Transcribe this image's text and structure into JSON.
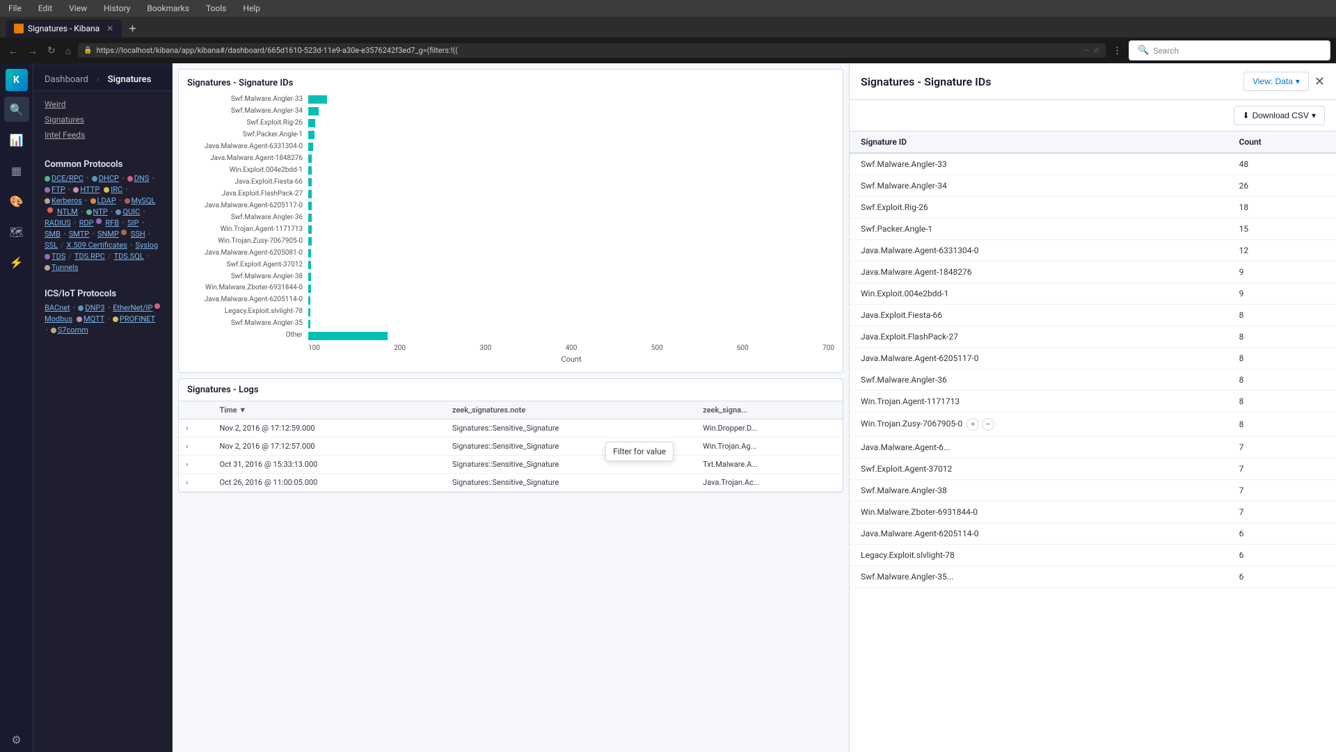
{
  "browser": {
    "menu": [
      "File",
      "Edit",
      "View",
      "History",
      "Bookmarks",
      "Tools",
      "Help"
    ],
    "tab_title": "Signatures - Kibana",
    "url": "https://localhost/kibana/app/kibana#/dashboard/665d1610-523d-11e9-a30e-e3576242f3ed7_g=(filters:!((",
    "search_placeholder": "Search"
  },
  "kibana": {
    "nav_items": [
      "discover",
      "visualize",
      "dashboard",
      "canvas",
      "maps",
      "ml",
      "settings"
    ],
    "header": {
      "breadcrumbs": [
        "Dashboard",
        "Signatures"
      ]
    }
  },
  "sidebar": {
    "items": [
      "Weird",
      "Signatures",
      "Intel Feeds"
    ],
    "common_protocols_title": "Common Protocols",
    "protocols": [
      {
        "label": "DCE/RPC",
        "color": "#54b399"
      },
      {
        "label": "DHCP",
        "color": "#6092c0"
      },
      {
        "label": "DNS",
        "color": "#d36086"
      },
      {
        "label": "FTP",
        "color": "#9170b8"
      },
      {
        "label": "HTTP",
        "color": "#ca8eae"
      },
      {
        "label": "IRC",
        "color": "#d6bf57"
      },
      {
        "label": "Kerberos",
        "color": "#b9a888"
      },
      {
        "label": "LDAP",
        "color": "#da8b45"
      },
      {
        "label": "MySQL",
        "color": "#aa6556"
      },
      {
        "label": "NTLM",
        "color": "#e7664c"
      },
      {
        "label": "NTP",
        "color": "#54b399"
      },
      {
        "label": "QUIC",
        "color": "#6092c0"
      },
      {
        "label": "RADIUS",
        "color": "#d36086"
      },
      {
        "label": "RDP",
        "color": "#9170b8"
      },
      {
        "label": "RFB",
        "color": "#ca8eae"
      },
      {
        "label": "SIP",
        "color": "#d6bf57"
      },
      {
        "label": "SMB",
        "color": "#b9a888"
      },
      {
        "label": "SMTP",
        "color": "#da8b45"
      },
      {
        "label": "SNMP",
        "color": "#aa6556"
      },
      {
        "label": "SSH",
        "color": "#e7664c"
      },
      {
        "label": "SSL",
        "color": "#54b399"
      },
      {
        "label": "X.509 Certificates",
        "color": "#6092c0"
      },
      {
        "label": "Syslog",
        "color": "#d36086"
      },
      {
        "label": "TDS",
        "color": "#9170b8"
      },
      {
        "label": "TDS.RPC",
        "color": "#ca8eae"
      },
      {
        "label": "TDS.SQL",
        "color": "#d6bf57"
      },
      {
        "label": "Tunnels",
        "color": "#b9a888"
      }
    ],
    "ics_title": "ICS/IoT Protocols",
    "ics_protocols": [
      {
        "label": "BACnet",
        "color": "#54b399"
      },
      {
        "label": "DNP3",
        "color": "#6092c0"
      },
      {
        "label": "EtherNet/IP",
        "color": "#d36086"
      },
      {
        "label": "Modbus",
        "color": "#9170b8"
      },
      {
        "label": "MQTT",
        "color": "#ca8eae"
      },
      {
        "label": "PROFINET",
        "color": "#d6bf57"
      },
      {
        "label": "S7comm",
        "color": "#b9a888"
      }
    ]
  },
  "chart": {
    "title": "Signatures - Signature IDs",
    "y_labels": [
      "Swf.Malware.Angler-33",
      "Swf.Malware.Angler-34",
      "Swf.Exploit.Rig-26",
      "Swf.Packer.Angle-1",
      "Java.Malware.Agent-6331304-0",
      "Java.Malware.Agent-1848276",
      "Win.Exploit.004e2bdd-1",
      "Java.Exploit.Fiesta-66",
      "Java.Exploit.FlashPack-27",
      "Java.Malware.Agent-6205117-0",
      "Swf.Malware.Angler-36",
      "Win.Trojan.Agent-1171713",
      "Win.Trojan.Zusy-7067905-0",
      "Java.Malware.Agent-6205081-0",
      "Swf.Exploit.Agent-37012",
      "Swf.Malware.Angler-38",
      "Win.Malware.Zboter-6931844-0",
      "Java.Malware.Agent-6205114-0",
      "Legacy.Exploit.slvlight-78",
      "Swf.Malware.Angler-35",
      "Other"
    ],
    "bar_values": [
      48,
      26,
      18,
      15,
      12,
      9,
      9,
      8,
      8,
      8,
      8,
      8,
      8,
      7,
      7,
      7,
      7,
      6,
      6,
      6,
      200
    ],
    "max_value": 700,
    "x_ticks": [
      "100",
      "200",
      "300",
      "400",
      "500",
      "600",
      "700"
    ],
    "x_label": "Count"
  },
  "flyout": {
    "title": "Signatures - Signature IDs",
    "view_data_label": "View: Data",
    "download_csv_label": "Download CSV",
    "table": {
      "columns": [
        "Signature ID",
        "Count"
      ],
      "rows": [
        {
          "id": "Swf.Malware.Angler-33",
          "count": 48
        },
        {
          "id": "Swf.Malware.Angler-34",
          "count": 26
        },
        {
          "id": "Swf.Exploit.Rig-26",
          "count": 18
        },
        {
          "id": "Swf.Packer.Angle-1",
          "count": 15
        },
        {
          "id": "Java.Malware.Agent-6331304-0",
          "count": 12
        },
        {
          "id": "Java.Malware.Agent-1848276",
          "count": 9
        },
        {
          "id": "Win.Exploit.004e2bdd-1",
          "count": 9
        },
        {
          "id": "Java.Exploit.Fiesta-66",
          "count": 8
        },
        {
          "id": "Java.Exploit.FlashPack-27",
          "count": 8
        },
        {
          "id": "Java.Malware.Agent-6205117-0",
          "count": 8
        },
        {
          "id": "Swf.Malware.Angler-36",
          "count": 8
        },
        {
          "id": "Win.Trojan.Agent-1171713",
          "count": 8
        },
        {
          "id": "Win.Trojan.Zusy-7067905-0",
          "count": 8,
          "tooltip": true
        },
        {
          "id": "Java.Malware.Agent-6...",
          "count": 7
        },
        {
          "id": "Swf.Exploit.Agent-37012",
          "count": 7
        },
        {
          "id": "Swf.Malware.Angler-38",
          "count": 7
        },
        {
          "id": "Win.Malware.Zboter-6931844-0",
          "count": 7
        },
        {
          "id": "Java.Malware.Agent-6205114-0",
          "count": 6
        },
        {
          "id": "Legacy.Exploit.slvlight-78",
          "count": 6
        },
        {
          "id": "Swf.Malware.Angler-35...",
          "count": 6
        }
      ]
    },
    "tooltip_text": "Filter for value"
  },
  "logs": {
    "title": "Signatures - Logs",
    "columns": [
      "Time",
      "zeek_signatures.note",
      "zeek_signa..."
    ],
    "rows": [
      {
        "time": "Nov 2, 2016 @ 17:12:59.000",
        "note": "Signatures::Sensitive_Signature",
        "sig": "Win.Dropper.D..."
      },
      {
        "time": "Nov 2, 2016 @ 17:12:57.000",
        "note": "Signatures::Sensitive_Signature",
        "sig": "Win.Trojan.Ag..."
      },
      {
        "time": "Oct 31, 2016 @ 15:33:13.000",
        "note": "Signatures::Sensitive_Signature",
        "sig": "Txt.Malware.A..."
      },
      {
        "time": "Oct 26, 2016 @ 11:00:05.000",
        "note": "Signatures::Sensitive_Signature",
        "sig": "Java.Trojan.Ac..."
      }
    ]
  }
}
